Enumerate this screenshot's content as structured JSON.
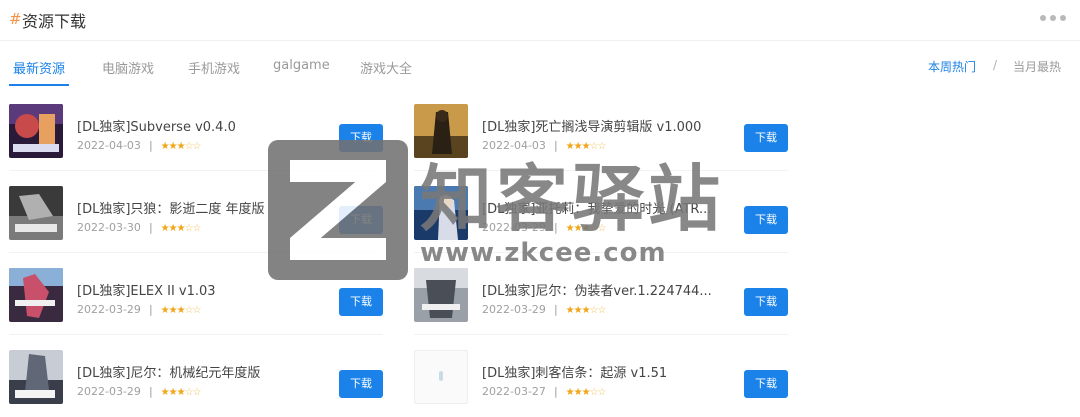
{
  "header": {
    "title": "资源下载",
    "hash": "#"
  },
  "tabs": {
    "left": [
      "最新资源",
      "电脑游戏",
      "手机游戏",
      "galgame",
      "游戏大全"
    ],
    "right": [
      "本周热门",
      "当月最热"
    ],
    "separator": "/"
  },
  "download_label": "下载",
  "items": [
    {
      "name": "[DL独家]Subverse v0.4.0",
      "date": "2022-04-03",
      "rating": 3.5,
      "icon": "subverse-thumb"
    },
    {
      "name": "[DL独家]死亡搁浅导演剪辑版 v1.000",
      "date": "2022-04-03",
      "rating": 3.5,
      "icon": "death-stranding-thumb"
    },
    {
      "name": "[DL独家]只狼：影逝二度 年度版",
      "date": "2022-03-30",
      "rating": 3.5,
      "icon": "sekiro-thumb"
    },
    {
      "name": "[DL独家]亚托莉：我挚爱的时光 (ATR...",
      "date": "2022-03-29",
      "rating": 3.5,
      "icon": "atri-thumb"
    },
    {
      "name": "[DL独家]ELEX II v1.03",
      "date": "2022-03-29",
      "rating": 3.5,
      "icon": "elex-thumb"
    },
    {
      "name": "[DL独家]尼尔：伪装者ver.1.224744...",
      "date": "2022-03-29",
      "rating": 3.5,
      "icon": "nier-replicant-thumb"
    },
    {
      "name": "[DL独家]尼尔：机械纪元年度版",
      "date": "2022-03-29",
      "rating": 3.5,
      "icon": "nier-automata-thumb"
    },
    {
      "name": "[DL独家]刺客信条：起源 v1.51",
      "date": "2022-03-27",
      "rating": 3.5,
      "icon": "ac-origins-thumb"
    }
  ],
  "watermark": {
    "text": "知客驿站",
    "url": "www.zkcee.com"
  },
  "colors": {
    "accent": "#1a82e8",
    "star": "#f2a516",
    "hash": "#f0944a"
  }
}
